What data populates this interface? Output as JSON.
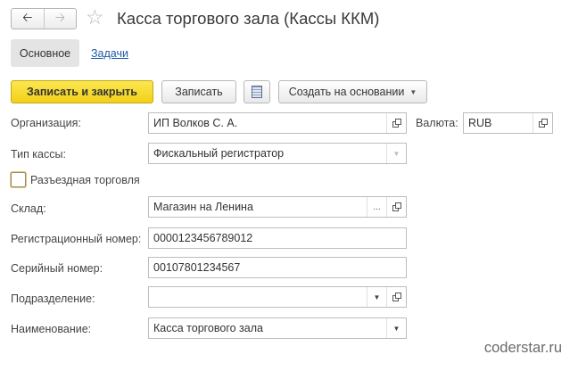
{
  "header": {
    "back_icon": "arrow-left-icon",
    "forward_icon": "arrow-right-icon",
    "favorite_icon": "star-icon",
    "title": "Касса торгового зала (Кассы ККМ)"
  },
  "tabs": {
    "main": "Основное",
    "tasks": "Задачи"
  },
  "toolbar": {
    "save_close_label": "Записать и закрыть",
    "save_label": "Записать",
    "list_icon": "list-icon",
    "create_based_label": "Создать на основании"
  },
  "form": {
    "organization": {
      "label": "Организация:",
      "value": "ИП Волков С. А."
    },
    "currency": {
      "label": "Валюта:",
      "value": "RUB"
    },
    "register_type": {
      "label": "Тип кассы:",
      "value": "Фискальный регистратор"
    },
    "mobile_trade": {
      "label": "Разъездная торговля",
      "checked": false
    },
    "warehouse": {
      "label": "Склад:",
      "value": "Магазин на Ленина"
    },
    "reg_number": {
      "label": "Регистрационный номер:",
      "value": "0000123456789012"
    },
    "serial_number": {
      "label": "Серийный номер:",
      "value": "00107801234567"
    },
    "department": {
      "label": "Подразделение:",
      "value": ""
    },
    "name": {
      "label": "Наименование:",
      "value": "Касса торгового зала"
    }
  },
  "colors": {
    "primary_button": "#f5d52a",
    "link": "#1f5aa6",
    "tab_active": "#e4e4e4"
  },
  "watermark": "coderstar.ru"
}
